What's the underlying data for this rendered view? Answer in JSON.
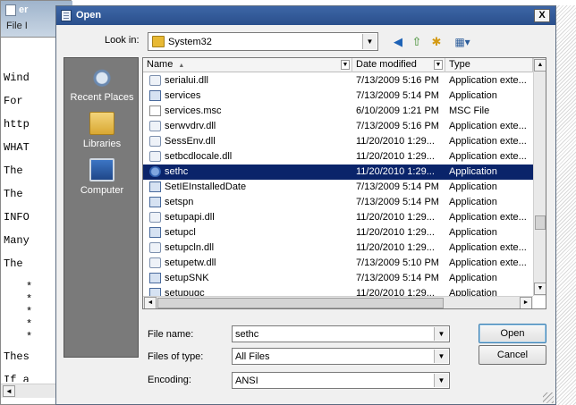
{
  "background_window": {
    "title": "er",
    "menu": "File  I",
    "lines": [
      "Wind",
      "For",
      "http",
      "WHAT",
      "The",
      "The",
      "INFO",
      "Many",
      "The",
      "*",
      "*",
      "*",
      "*",
      "*",
      "Thes",
      "If a"
    ],
    "scroll_left": "◄"
  },
  "dialog": {
    "title": "Open",
    "close": "X",
    "look_in_label": "Look in:",
    "look_in_value": "System32",
    "dropdown_glyph": "▼",
    "toolbar": {
      "back": "◀",
      "up": "⇧",
      "new_folder": "✱",
      "views": "▦▾"
    },
    "places": [
      {
        "label": "Recent Places",
        "icon": "recent-places-icon"
      },
      {
        "label": "Libraries",
        "icon": "libraries-icon"
      },
      {
        "label": "Computer",
        "icon": "computer-icon"
      }
    ],
    "columns": {
      "name": "Name",
      "date": "Date modified",
      "type": "Type",
      "sort": "▲"
    },
    "files": [
      {
        "name": "serialui.dll",
        "date": "7/13/2009 5:16 PM",
        "type": "Application exte...",
        "icon": "dll"
      },
      {
        "name": "services",
        "date": "7/13/2009 5:14 PM",
        "type": "Application",
        "icon": "app"
      },
      {
        "name": "services.msc",
        "date": "6/10/2009 1:21 PM",
        "type": "MSC File",
        "icon": "doc"
      },
      {
        "name": "serwvdrv.dll",
        "date": "7/13/2009 5:16 PM",
        "type": "Application exte...",
        "icon": "dll"
      },
      {
        "name": "SessEnv.dll",
        "date": "11/20/2010 1:29...",
        "type": "Application exte...",
        "icon": "dll"
      },
      {
        "name": "setbcdlocale.dll",
        "date": "11/20/2010 1:29...",
        "type": "Application exte...",
        "icon": "dll"
      },
      {
        "name": "sethc",
        "date": "11/20/2010 1:29...",
        "type": "Application",
        "icon": "sethc",
        "selected": true
      },
      {
        "name": "SetIEInstalledDate",
        "date": "7/13/2009 5:14 PM",
        "type": "Application",
        "icon": "app"
      },
      {
        "name": "setspn",
        "date": "7/13/2009 5:14 PM",
        "type": "Application",
        "icon": "app"
      },
      {
        "name": "setupapi.dll",
        "date": "11/20/2010 1:29...",
        "type": "Application exte...",
        "icon": "dll"
      },
      {
        "name": "setupcl",
        "date": "11/20/2010 1:29...",
        "type": "Application",
        "icon": "app"
      },
      {
        "name": "setupcln.dll",
        "date": "11/20/2010 1:29...",
        "type": "Application exte...",
        "icon": "dll"
      },
      {
        "name": "setupetw.dll",
        "date": "7/13/2009 5:10 PM",
        "type": "Application exte...",
        "icon": "dll"
      },
      {
        "name": "setupSNK",
        "date": "7/13/2009 5:14 PM",
        "type": "Application",
        "icon": "app"
      },
      {
        "name": "setupugc",
        "date": "11/20/2010 1:29...",
        "type": "Application",
        "icon": "app"
      }
    ],
    "scroll": {
      "up": "▲",
      "down": "▼",
      "left": "◄",
      "right": "►"
    },
    "file_name_label": "File name:",
    "file_name_value": "sethc",
    "files_of_type_label": "Files of type:",
    "files_of_type_value": "All Files",
    "encoding_label": "Encoding:",
    "encoding_value": "ANSI",
    "open_button": "Open",
    "cancel_button": "Cancel"
  }
}
